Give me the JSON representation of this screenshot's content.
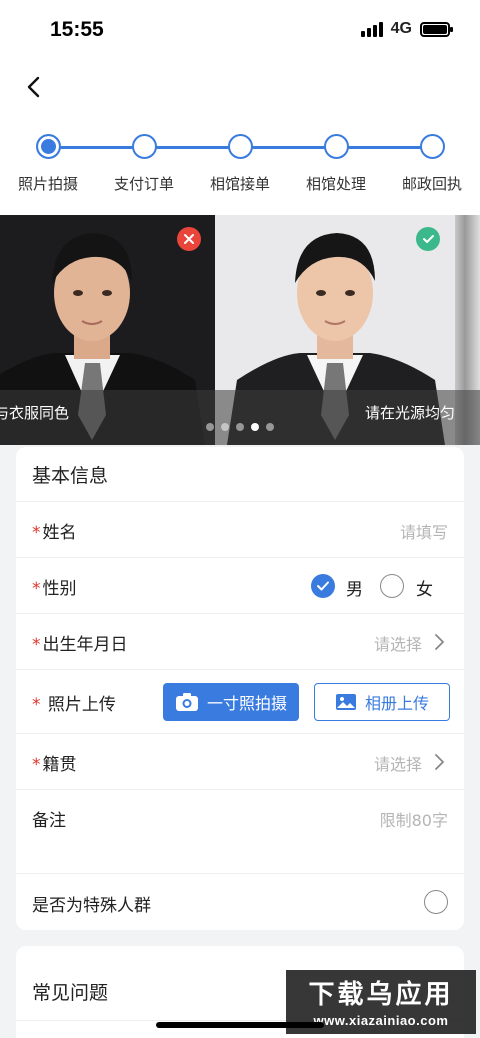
{
  "status_bar": {
    "time": "15:55",
    "network": "4G"
  },
  "steps": [
    {
      "label": "照片拍摄",
      "active": true
    },
    {
      "label": "支付订单",
      "active": false
    },
    {
      "label": "相馆接单",
      "active": false
    },
    {
      "label": "相馆处理",
      "active": false
    },
    {
      "label": "邮政回执",
      "active": false
    }
  ],
  "carousel": {
    "captions": [
      "与衣服同色",
      "请在光源均匀的"
    ],
    "page_count": 5,
    "active_index": 3
  },
  "basic_info": {
    "title": "基本信息",
    "required_mark": "*",
    "name": {
      "label": "姓名",
      "placeholder": "请填写"
    },
    "gender": {
      "label": "性别",
      "options": [
        "男",
        "女"
      ],
      "selected": "男"
    },
    "birth": {
      "label": "出生年月日",
      "placeholder": "请选择"
    },
    "photo": {
      "label": "照片上传",
      "camera_button": "一寸照拍摄",
      "album_button": "相册上传"
    },
    "origin": {
      "label": "籍贯",
      "placeholder": "请选择"
    },
    "remark": {
      "label": "备注",
      "placeholder": "限制80字"
    },
    "special": {
      "label": "是否为特殊人群"
    }
  },
  "faq": {
    "title": "常见问题"
  },
  "watermark": {
    "main": "下载乌应用",
    "sub": "www.xiazainiao.com"
  },
  "colors": {
    "accent": "#3a7be0",
    "required": "#e0352b",
    "reject": "#e9453b",
    "accept": "#3cb98a"
  }
}
